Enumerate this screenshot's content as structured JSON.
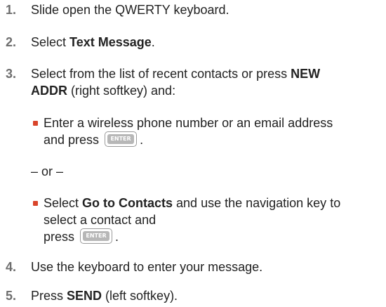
{
  "steps": [
    {
      "number": "1.",
      "segments": [
        {
          "text": "Slide open the QWERTY keyboard.",
          "bold": false
        }
      ]
    },
    {
      "number": "2.",
      "segments": [
        {
          "text": "Select ",
          "bold": false
        },
        {
          "text": "Text Message",
          "bold": true
        },
        {
          "text": ".",
          "bold": false
        }
      ]
    },
    {
      "number": "3.",
      "line1": [
        {
          "text": "Select from the list of recent contacts or press ",
          "bold": false
        },
        {
          "text": "NEW",
          "bold": true
        }
      ],
      "line2": [
        {
          "text": "ADDR",
          "bold": true
        },
        {
          "text": " (right softkey) and:",
          "bold": false
        }
      ]
    },
    {
      "number": "4.",
      "segments": [
        {
          "text": "Use the keyboard to enter your message.",
          "bold": false
        }
      ]
    },
    {
      "number": "5.",
      "segments": [
        {
          "text": "Press ",
          "bold": false
        },
        {
          "text": "SEND",
          "bold": true
        },
        {
          "text": " (left softkey).",
          "bold": false
        }
      ]
    }
  ],
  "sub_a": {
    "line1": "Enter a wireless phone number or an email address",
    "line2_prefix": "and press",
    "line2_suffix": "."
  },
  "or_text": "– or –",
  "sub_b": {
    "line1_pre": "Select ",
    "line1_bold": "Go to Contacts",
    "line1_post": " and use the navigation key to",
    "line2": "select a contact and",
    "line3_prefix": "press",
    "line3_suffix": "."
  },
  "key_label": "ENTER",
  "colors": {
    "number": "#6e6e6e",
    "bullet": "#d9452b",
    "text": "#222222"
  }
}
